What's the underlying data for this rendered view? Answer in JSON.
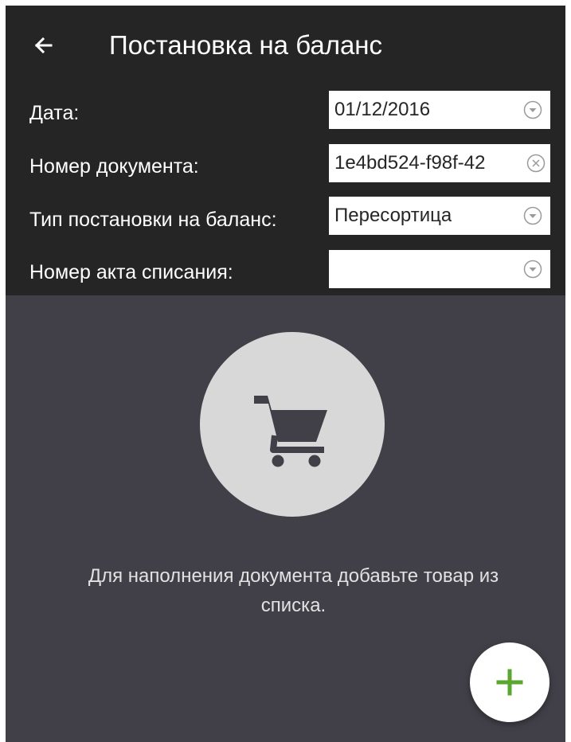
{
  "header": {
    "title": "Постановка на баланс",
    "back_icon": "arrow-left-icon"
  },
  "form": {
    "date": {
      "label": "Дата:",
      "value": "01/12/2016",
      "icon": "dropdown-circle-icon"
    },
    "document_number": {
      "label": "Номер документа:",
      "value": "1e4bd524-f98f-42",
      "icon": "clear-circle-icon"
    },
    "balance_type": {
      "label": "Тип постановки на баланс:",
      "value": "Пересортица",
      "icon": "dropdown-circle-icon"
    },
    "write_off_act": {
      "label": "Номер акта списания:",
      "value": "",
      "icon": "dropdown-circle-icon"
    }
  },
  "empty_state": {
    "icon": "shopping-cart-icon",
    "message": "Для наполнения документа добавьте товар из списка."
  },
  "fab": {
    "icon": "plus-icon",
    "color": "#5aa62e"
  },
  "colors": {
    "header_background": "#252525",
    "body_background": "#414048",
    "field_background": "#ffffff",
    "circle_background": "#d8d8d8",
    "cart_color": "#414048"
  }
}
